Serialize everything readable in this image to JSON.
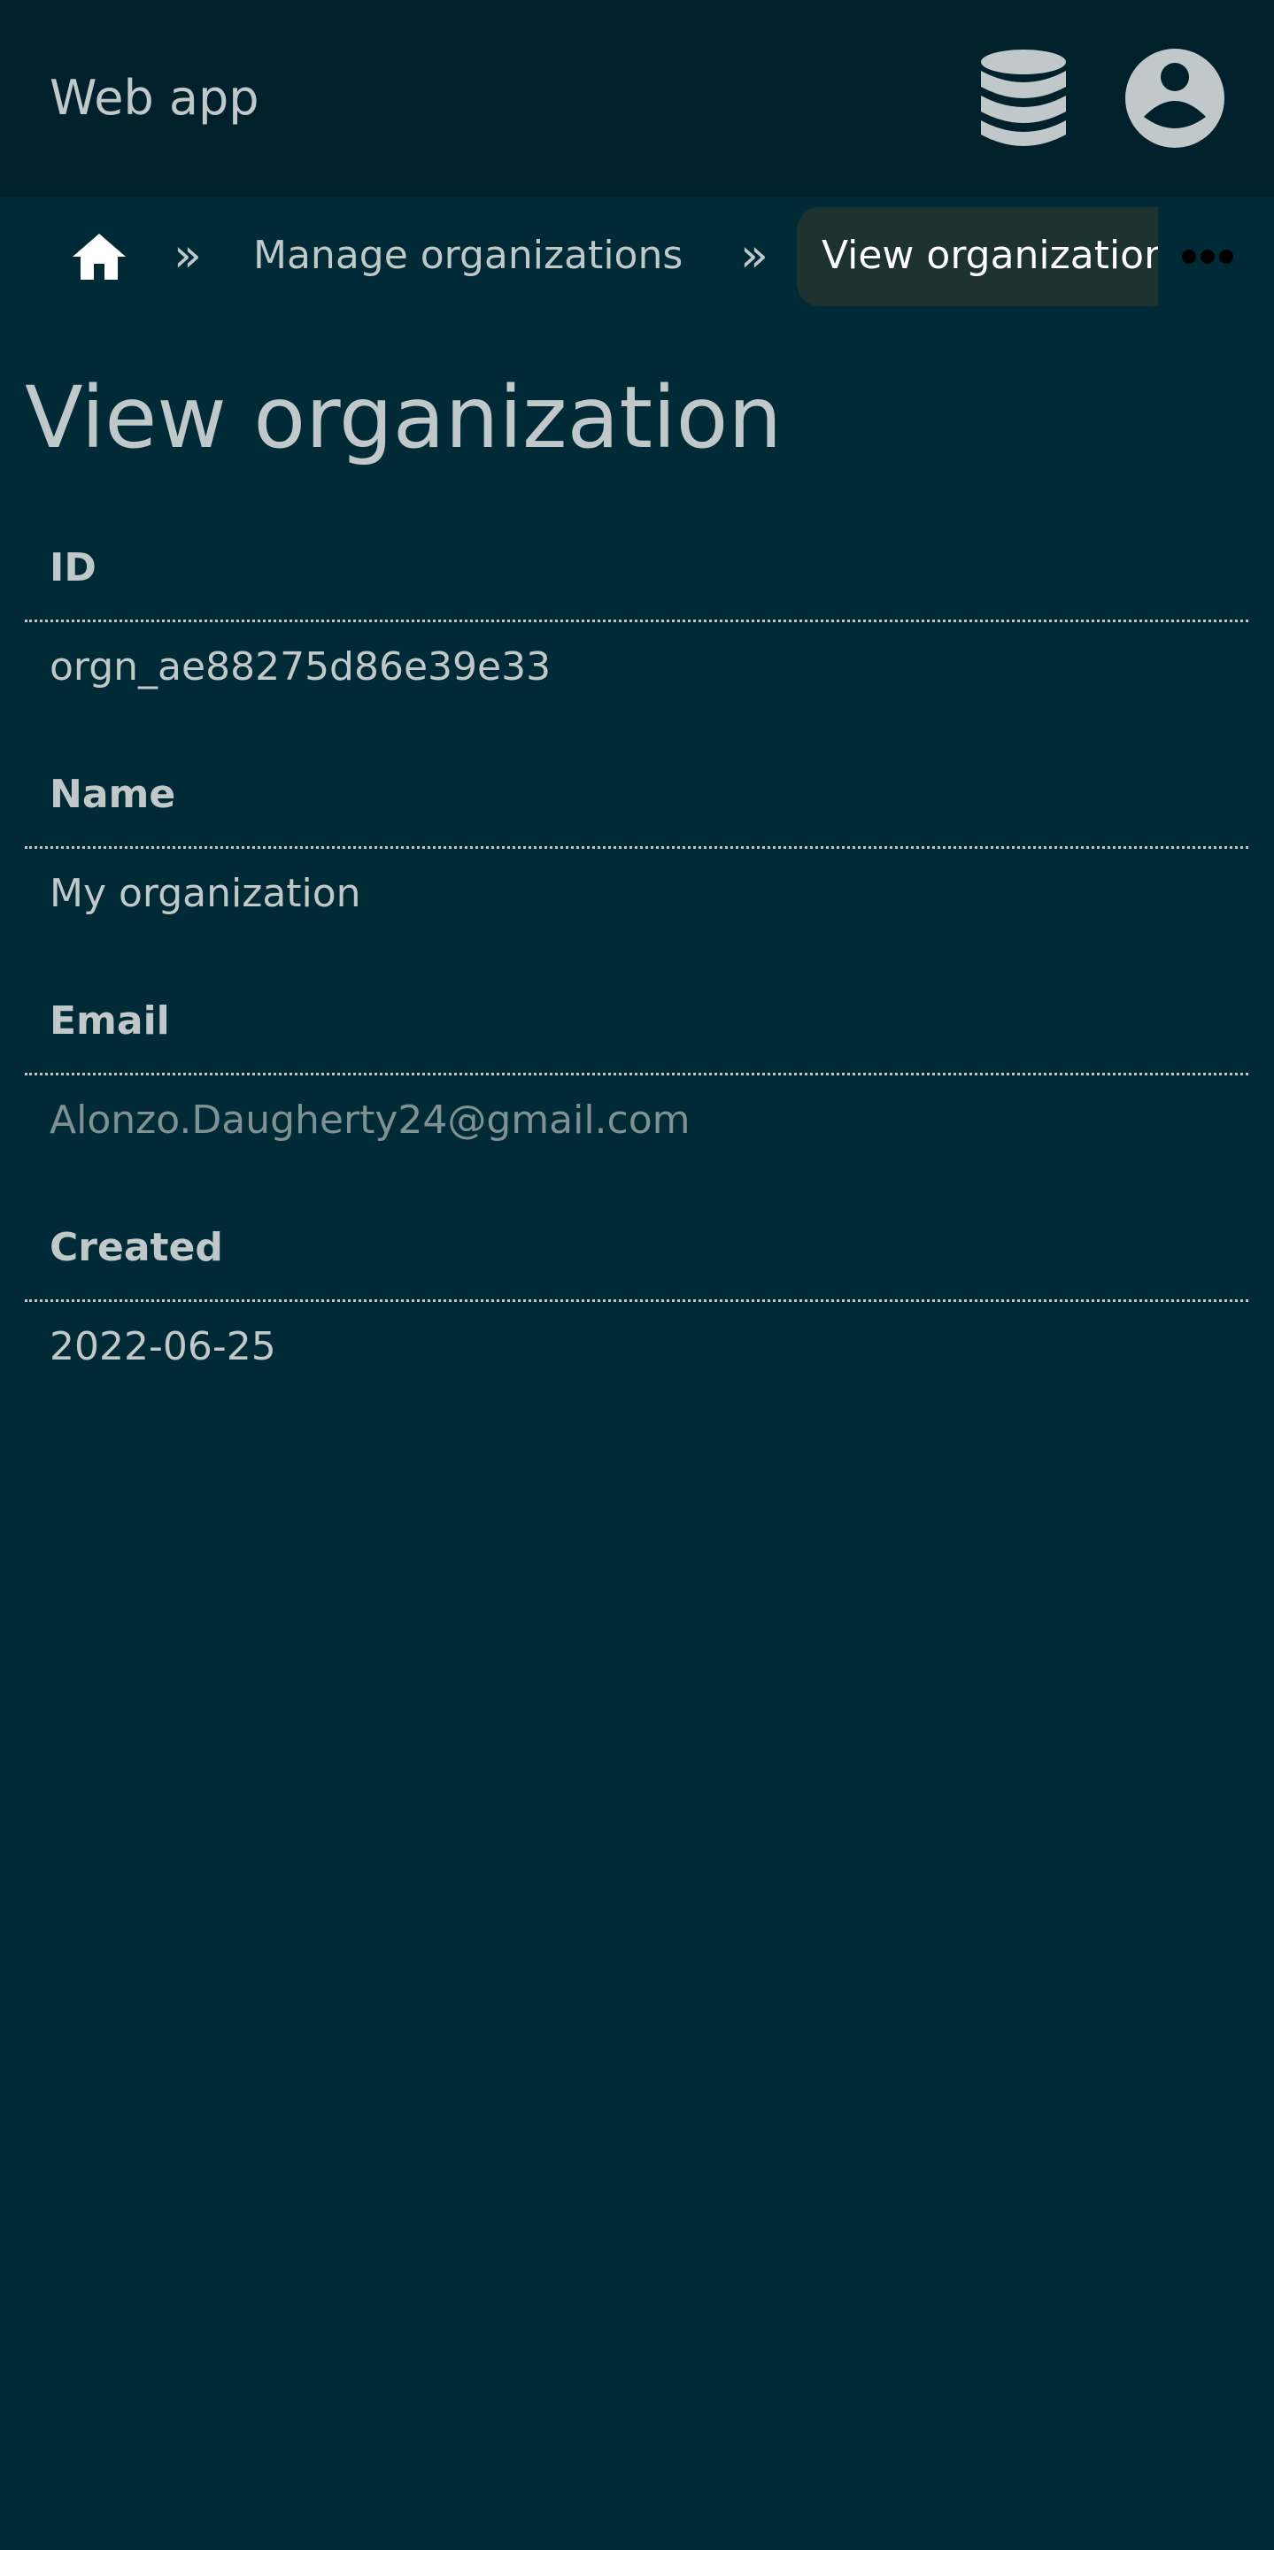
{
  "header": {
    "app_title": "Web app"
  },
  "breadcrumb": {
    "items": [
      {
        "label": "Manage organizations"
      },
      {
        "label": "View organization"
      }
    ],
    "separator": "»"
  },
  "page": {
    "title": "View organization"
  },
  "fields": [
    {
      "label": "ID",
      "value": "orgn_ae88275d86e39e33"
    },
    {
      "label": "Name",
      "value": "My organization"
    },
    {
      "label": "Email",
      "value": "Alonzo.Daugherty24@gmail.com"
    },
    {
      "label": "Created",
      "value": "2022-06-25"
    }
  ],
  "icons": {
    "database": "database-icon",
    "account": "account-circle-icon",
    "home": "home-icon",
    "more": "more-horizontal-icon"
  },
  "colors": {
    "background": "#002b36",
    "header": "#00212b",
    "text": "#c0c8c9",
    "muted_text": "#7f9194",
    "active_crumb": "#1e3330"
  }
}
